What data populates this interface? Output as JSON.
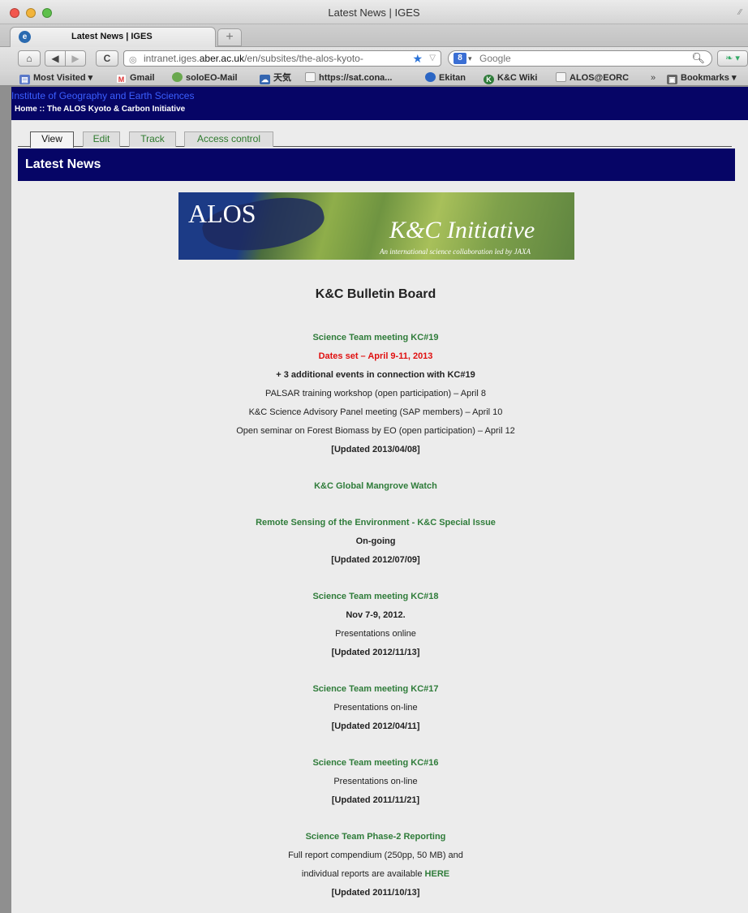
{
  "window": {
    "title": "Latest News | IGES"
  },
  "browser": {
    "tab_title": "Latest News | IGES",
    "new_tab": "+",
    "url_prefix": "intranet.iges.",
    "url_domain": "aber.ac.uk",
    "url_suffix": "/en/subsites/the-alos-kyoto-",
    "search_placeholder": "Google",
    "bookmarks": [
      {
        "label": "Most Visited ▾",
        "icon": "most-visited-icon"
      },
      {
        "label": "Gmail",
        "icon": "gmail-icon"
      },
      {
        "label": "soloEO-Mail",
        "icon": "mail-icon"
      },
      {
        "label": "天気",
        "icon": "weather-icon"
      },
      {
        "label": "https://sat.cona...",
        "icon": "page-icon"
      },
      {
        "label": "Ekitan",
        "icon": "ekitan-icon"
      },
      {
        "label": "K&C Wiki",
        "icon": "wiki-icon"
      },
      {
        "label": "ALOS@EORC",
        "icon": "page-icon"
      }
    ],
    "bookmarks_menu": "Bookmarks ▾",
    "overflow": "»"
  },
  "site": {
    "name": "Institute of Geography and Earth Sciences",
    "breadcrumb": "Home :: The ALOS Kyoto & Carbon Initiative"
  },
  "tabs": [
    "View",
    "Edit",
    "Track",
    "Access control"
  ],
  "page_title": "Latest News",
  "banner": {
    "alos": "ALOS",
    "initiative": "K&C Initiative",
    "tagline": "An international science collaboration led by JAXA"
  },
  "bulletin": {
    "heading": "K&C Bulletin Board",
    "kc19": {
      "title": "Science Team meeting KC#19",
      "dates": "Dates set – April 9-11, 2013",
      "additional": "+ 3 additional events in connection with KC#19",
      "event1": "PALSAR training workshop (open participation) – April 8",
      "event2": "K&C Science Advisory Panel meeting (SAP members) – April 10",
      "event3": "Open seminar on Forest Biomass by EO (open participation) – April 12",
      "updated": "[Updated 2013/04/08]"
    },
    "mangrove": {
      "title": "K&C Global Mangrove Watch"
    },
    "rse": {
      "title": "Remote Sensing of the Environment - K&C Special Issue",
      "status": "On-going",
      "updated": "[Updated 2012/07/09]"
    },
    "kc18": {
      "title": "Science Team meeting KC#18",
      "dates": "Nov 7-9, 2012.",
      "note": "Presentations online",
      "updated": "[Updated 2012/11/13]"
    },
    "kc17": {
      "title": "Science Team meeting KC#17",
      "note": "Presentations on-line",
      "updated": "[Updated 2012/04/11]"
    },
    "kc16": {
      "title": "Science Team meeting KC#16",
      "note": "Presentations on-line",
      "updated": "[Updated 2011/11/21]"
    },
    "phase2": {
      "title": "Science Team Phase-2 Reporting",
      "line1": "Full report compendium (250pp, 50 MB) and",
      "line2_prefix": "individual reports are available ",
      "line2_link": "HERE",
      "updated": "[Updated 2011/10/13]"
    }
  },
  "colors": {
    "header_navy": "#060566",
    "link_green": "#2f7c3a",
    "alert_red": "#e01010",
    "site_name_blue": "#3b5fff"
  }
}
